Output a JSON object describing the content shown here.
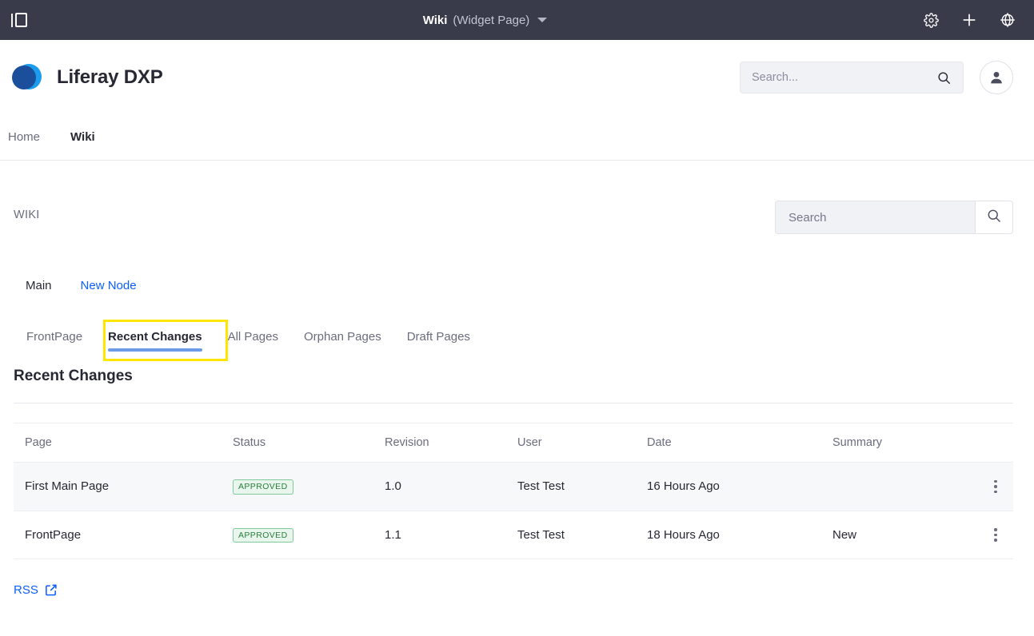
{
  "control_bar": {
    "panel_toggle_icon": "panel-toggle-icon",
    "title": "Wiki",
    "subtitle": "(Widget Page)",
    "dropdown_icon": "chevron-down-icon",
    "actions": [
      {
        "icon": "gear-icon",
        "name": "settings"
      },
      {
        "icon": "plus-icon",
        "name": "add"
      },
      {
        "icon": "globe-icon",
        "name": "simulation"
      }
    ]
  },
  "site_header": {
    "brand_name": "Liferay DXP",
    "logo_icon": "liferay-logo-icon",
    "logo_color_light": "#1c9ced",
    "logo_color_dark": "#1b4f9c",
    "search": {
      "placeholder": "Search...",
      "value": "",
      "icon": "search-icon"
    },
    "avatar_icon": "user-avatar-icon"
  },
  "site_nav": {
    "items": [
      {
        "label": "Home",
        "active": false
      },
      {
        "label": "Wiki",
        "active": true
      }
    ]
  },
  "portlet": {
    "label": "WIKI",
    "search": {
      "placeholder": "Search",
      "value": "",
      "button_icon": "search-icon"
    },
    "node_tabs": [
      {
        "label": "Main",
        "style": "current"
      },
      {
        "label": "New Node",
        "style": "link"
      }
    ],
    "wiki_tabs": [
      {
        "label": "FrontPage",
        "active": false
      },
      {
        "label": "Recent Changes",
        "active": true
      },
      {
        "label": "All Pages",
        "active": false
      },
      {
        "label": "Orphan Pages",
        "active": false
      },
      {
        "label": "Draft Pages",
        "active": false
      }
    ],
    "highlight_color": "#ffe600",
    "active_tab_underline_color": "#6c9ce8",
    "section_title": "Recent Changes",
    "table": {
      "columns": [
        "Page",
        "Status",
        "Revision",
        "User",
        "Date",
        "Summary"
      ],
      "rows": [
        {
          "page": "First Main Page",
          "status": "APPROVED",
          "revision": "1.0",
          "user": "Test Test",
          "date": "16 Hours Ago",
          "summary": "",
          "actions_icon": "kebab-menu-icon"
        },
        {
          "page": "FrontPage",
          "status": "APPROVED",
          "revision": "1.1",
          "user": "Test Test",
          "date": "18 Hours Ago",
          "summary": "New",
          "actions_icon": "kebab-menu-icon"
        }
      ],
      "status_colors": {
        "approved_text": "#287d3c",
        "approved_bg": "#e8f6ed",
        "approved_border": "#7fc99a"
      }
    },
    "rss": {
      "label": "RSS",
      "icon": "external-link-icon"
    }
  }
}
